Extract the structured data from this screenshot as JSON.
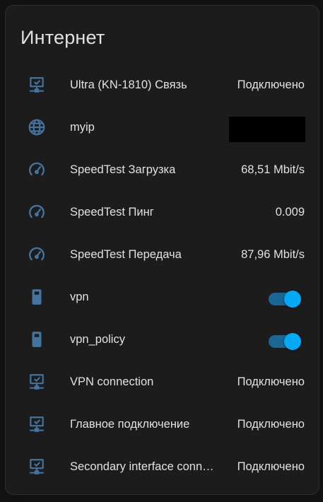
{
  "card": {
    "title": "Интернет"
  },
  "colors": {
    "icon": "#44739e",
    "toggle_on": "#03a9f4",
    "text": "#e1e1e1",
    "card_bg": "#1c1c1c"
  },
  "rows": [
    {
      "icon": "lan-connect-icon",
      "name": "Ultra (KN-1810) Связь",
      "state": "Подключено"
    },
    {
      "icon": "globe-icon",
      "name": "myip",
      "state_redacted": true
    },
    {
      "icon": "speedometer-icon",
      "name": "SpeedTest Загрузка",
      "state": "68,51 Mbit/s"
    },
    {
      "icon": "speedometer-icon",
      "name": "SpeedTest Пинг",
      "state": "0.009"
    },
    {
      "icon": "speedometer-icon",
      "name": "SpeedTest Передача",
      "state": "87,96 Mbit/s"
    },
    {
      "icon": "router-icon",
      "name": "vpn",
      "toggle_on": true
    },
    {
      "icon": "router-icon",
      "name": "vpn_policy",
      "toggle_on": true
    },
    {
      "icon": "lan-connect-icon",
      "name": "VPN connection",
      "state": "Подключено"
    },
    {
      "icon": "lan-connect-icon",
      "name": "Главное подключение",
      "state": "Подключено"
    },
    {
      "icon": "lan-connect-icon",
      "name": "Secondary interface connection",
      "state": "Подключено"
    }
  ]
}
